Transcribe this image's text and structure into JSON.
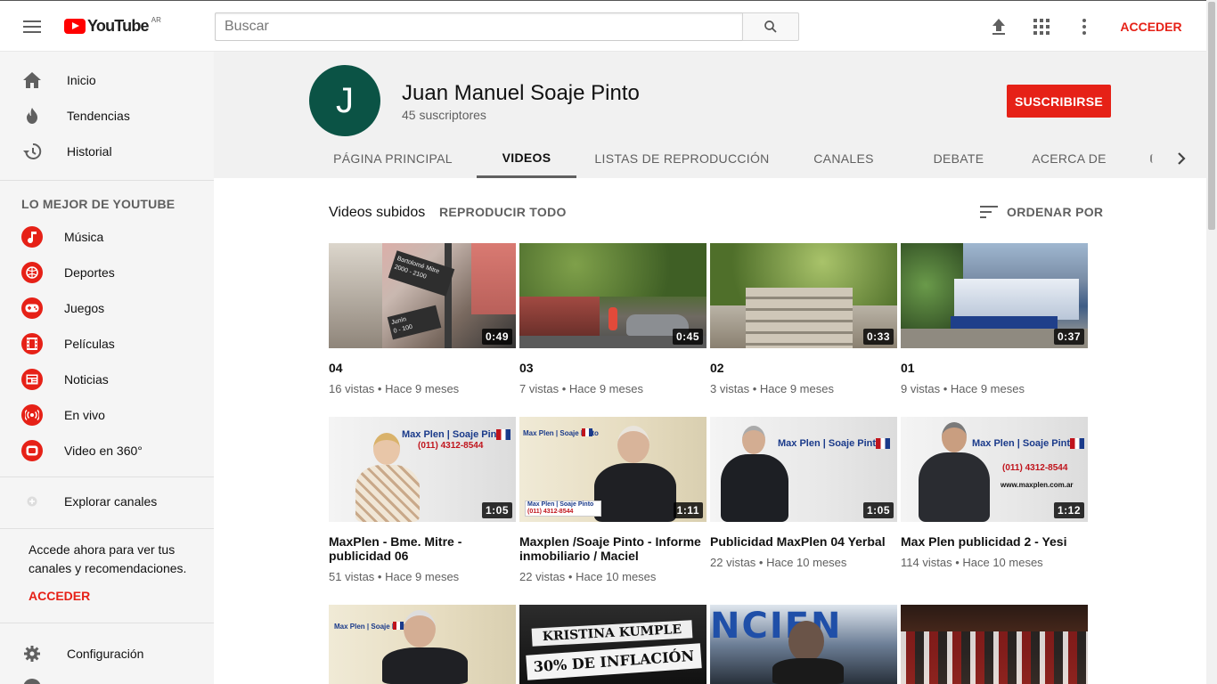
{
  "topbar": {
    "logo_text": "YouTube",
    "logo_country": "AR",
    "search_placeholder": "Buscar",
    "signin_label": "ACCEDER"
  },
  "sidebar": {
    "main": [
      {
        "label": "Inicio",
        "icon": "home-icon"
      },
      {
        "label": "Tendencias",
        "icon": "flame-icon"
      },
      {
        "label": "Historial",
        "icon": "history-icon"
      }
    ],
    "best_heading": "LO MEJOR DE YOUTUBE",
    "best": [
      {
        "label": "Música",
        "icon": "music-icon"
      },
      {
        "label": "Deportes",
        "icon": "sports-icon"
      },
      {
        "label": "Juegos",
        "icon": "gamepad-icon"
      },
      {
        "label": "Películas",
        "icon": "film-icon"
      },
      {
        "label": "Noticias",
        "icon": "news-icon"
      },
      {
        "label": "En vivo",
        "icon": "live-icon"
      },
      {
        "label": "Video en 360°",
        "icon": "360-icon"
      }
    ],
    "explore": "Explorar canales",
    "signin_prompt": "Accede ahora para ver tus canales y recomendaciones.",
    "signin_label": "ACCEDER",
    "settings": "Configuración"
  },
  "channel": {
    "avatar_letter": "J",
    "name": "Juan Manuel Soaje Pinto",
    "subscribers": "45 suscriptores",
    "subscribe_label": "SUSCRIBIRSE",
    "tabs": [
      "PÁGINA PRINCIPAL",
      "VIDEOS",
      "LISTAS DE REPRODUCCIÓN",
      "CANALES",
      "DEBATE",
      "ACERCA DE"
    ],
    "active_tab": "VIDEOS"
  },
  "videos_section": {
    "title": "Videos subidos",
    "play_all": "REPRODUCIR TODO",
    "sort_label": "ORDENAR POR"
  },
  "videos": [
    {
      "title": "04",
      "duration": "0:49",
      "views": "16 vistas",
      "age": "Hace 9 meses"
    },
    {
      "title": "03",
      "duration": "0:45",
      "views": "7 vistas",
      "age": "Hace 9 meses"
    },
    {
      "title": "02",
      "duration": "0:33",
      "views": "3 vistas",
      "age": "Hace 9 meses"
    },
    {
      "title": "01",
      "duration": "0:37",
      "views": "9 vistas",
      "age": "Hace 9 meses"
    },
    {
      "title": "MaxPlen - Bme. Mitre - publicidad 06",
      "duration": "1:05",
      "views": "51 vistas",
      "age": "Hace 9 meses"
    },
    {
      "title": "Maxplen /Soaje Pinto - Informe inmobiliario / Maciel",
      "duration": "1:11",
      "views": "22 vistas",
      "age": "Hace 10 meses"
    },
    {
      "title": "Publicidad MaxPlen 04 Yerbal",
      "duration": "1:05",
      "views": "22 vistas",
      "age": "Hace 10 meses"
    },
    {
      "title": "Max Plen publicidad 2 - Yesi",
      "duration": "1:12",
      "views": "114 vistas",
      "age": "Hace 10 meses"
    }
  ],
  "thumb_text": {
    "street_sign_1": "Bartolomé Mitre",
    "street_sign_2": "2000 - 2100",
    "street_sign_3": "Junín",
    "street_sign_4": "0 - 100",
    "brand": "Max Plen | Soaje Pinto",
    "phone": "(011) 4312-8544",
    "web": "www.maxplen.com.ar",
    "protest_1": "KRISTINA KUMPLE",
    "protest_2": "30% DE INFLACIÓN",
    "banner": "NCIEN"
  },
  "colors": {
    "brand_red": "#e62117",
    "avatar_bg": "#0b5345"
  }
}
